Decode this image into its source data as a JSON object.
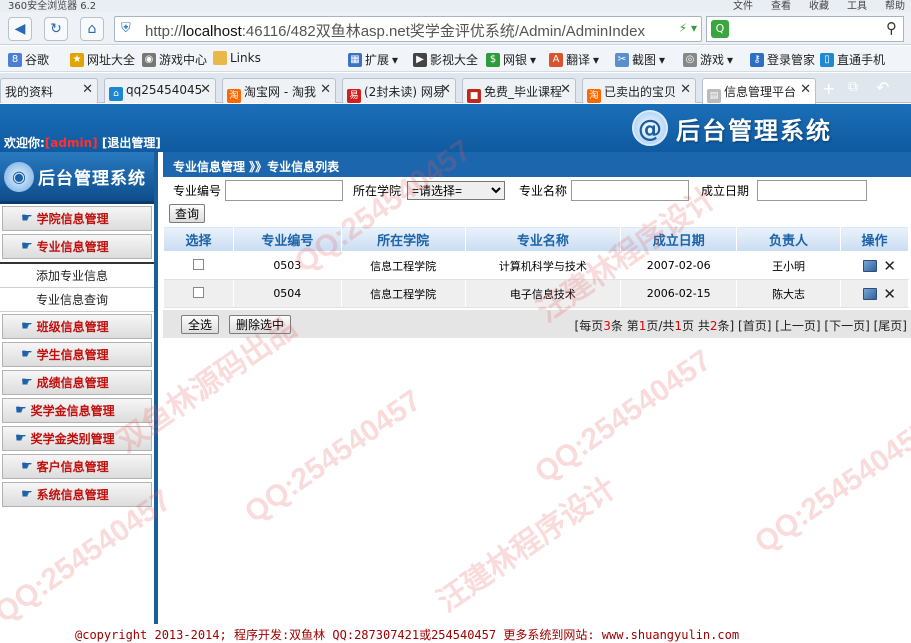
{
  "browser": {
    "title": "360安全浏览器 6.2",
    "menus": [
      "文件",
      "查看",
      "收藏",
      "工具",
      "帮助"
    ],
    "url_prefix": "http://",
    "url_host": "localhost",
    "url_rest": ":46116/482双鱼林asp.net奖学金评优系统/Admin/AdminIndex",
    "bookmarks": [
      "谷歌",
      "网址大全",
      "游戏中心",
      "Links",
      "扩展",
      "影视大全",
      "网银",
      "翻译",
      "截图",
      "游戏",
      "登录管家",
      "直通手机"
    ],
    "tabs": [
      "我的资料",
      "qq25454045",
      "淘宝网 - 淘我",
      "(2封未读) 网易",
      "免费_毕业课程",
      "已卖出的宝贝",
      "信息管理平台"
    ]
  },
  "header": {
    "welcome_label": "欢迎你:",
    "username": "[admin]",
    "logout": "[退出管理]",
    "brand_at": "@",
    "brand_title": "后台管理系统"
  },
  "sidebar": {
    "title": "后台管理系统",
    "menu": [
      {
        "label": "学院信息管理"
      },
      {
        "label": "专业信息管理"
      },
      {
        "label": "班级信息管理"
      },
      {
        "label": "学生信息管理"
      },
      {
        "label": "成绩信息管理"
      },
      {
        "label": "奖学金信息管理"
      },
      {
        "label": "奖学金类别管理"
      },
      {
        "label": "客户信息管理"
      },
      {
        "label": "系统信息管理"
      }
    ],
    "submenu": [
      "添加专业信息",
      "专业信息查询"
    ]
  },
  "main": {
    "breadcrumb": "专业信息管理 》》专业信息列表",
    "filters": {
      "code_label": "专业编号",
      "college_label": "所在学院",
      "college_selected": "=请选择=",
      "name_label": "专业名称",
      "date_label": "成立日期",
      "query_button": "查询"
    },
    "table": {
      "headers": [
        "选择",
        "专业编号",
        "所在学院",
        "专业名称",
        "成立日期",
        "负责人",
        "操作"
      ],
      "rows": [
        {
          "code": "0503",
          "college": "信息工程学院",
          "name": "计算机科学与技术",
          "date": "2007-02-06",
          "owner": "王小明"
        },
        {
          "code": "0504",
          "college": "信息工程学院",
          "name": "电子信息技术",
          "date": "2006-02-15",
          "owner": "陈大志"
        }
      ]
    },
    "buttons": {
      "select_all": "全选",
      "delete_selected": "删除选中"
    },
    "pager": {
      "prefix": "[每页",
      "per_page": "3",
      "mid1": "条 第",
      "current": "1",
      "mid2": "页/共",
      "pages": "1",
      "mid3": "页 共",
      "total": "2",
      "suffix": "条]",
      "first": "[首页]",
      "prev": "[上一页]",
      "next": "[下一页]",
      "last": "[尾页]"
    }
  },
  "footer": {
    "copyright": "@copyright 2013-2014; 程序开发:双鱼林  QQ:287307421或254540457  更多系统到网站: www.shuangyulin.com"
  },
  "watermarks": [
    "QQ:254540457",
    "汪建林程序设计",
    "双鱼林源码出品"
  ]
}
